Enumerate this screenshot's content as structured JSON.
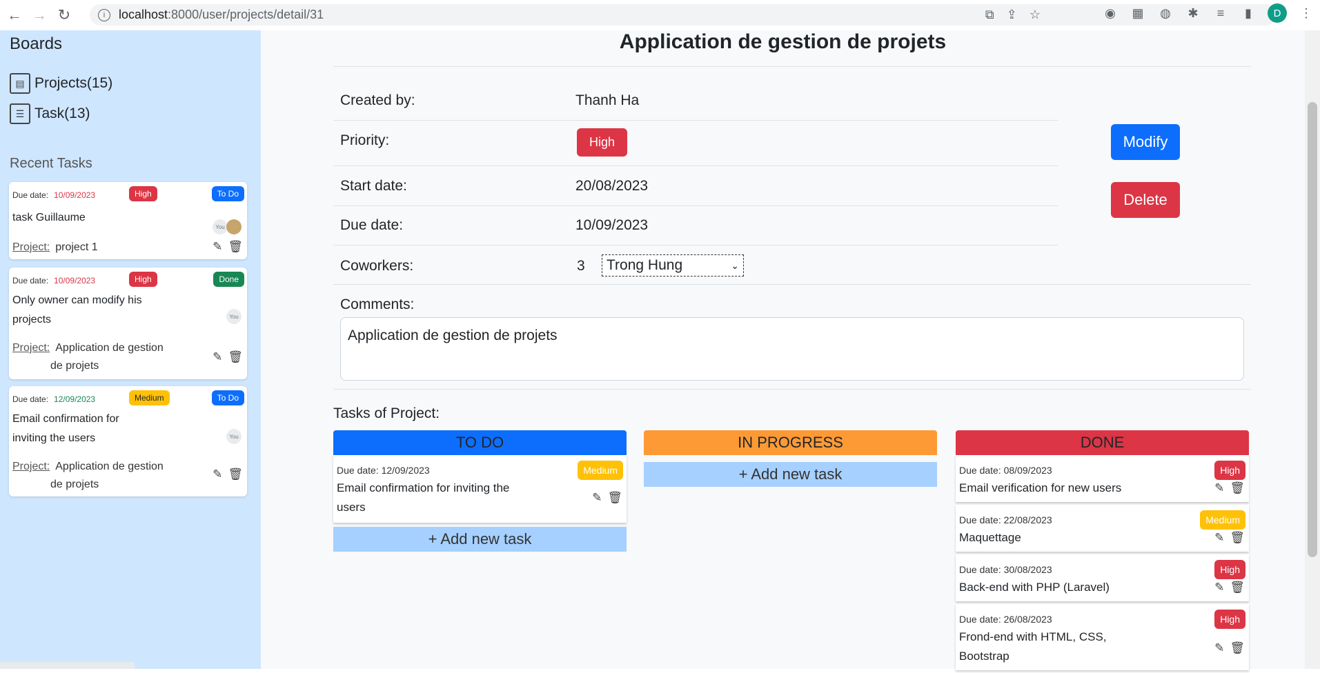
{
  "browser": {
    "url_host": "localhost",
    "url_path": ":8000/user/projects/detail/31",
    "avatar_letter": "D"
  },
  "sidebar": {
    "title": "Boards",
    "links": [
      {
        "label": "Projects(15)"
      },
      {
        "label": "Task(13)"
      }
    ],
    "recent_title": "Recent Tasks",
    "due_label": "Due date:",
    "project_label": "Project:",
    "you_label": "You",
    "tasks": [
      {
        "date": "10/09/2023",
        "priority": "High",
        "status": "To Do",
        "title": "task Guillaume",
        "project": "project 1"
      },
      {
        "date": "10/09/2023",
        "priority": "High",
        "status": "Done",
        "title_line1": "Only owner can modify his",
        "title_line2": "projects",
        "project_line1": "Application de gestion",
        "project_line2": "de projets"
      },
      {
        "date": "12/09/2023",
        "priority": "Medium",
        "status": "To Do",
        "title_line1": "Email confirmation for",
        "title_line2": "inviting the users",
        "project_line1": "Application de gestion",
        "project_line2": "de projets"
      }
    ]
  },
  "project": {
    "title": "Application de gestion de projets",
    "created_by_label": "Created by:",
    "created_by": "Thanh Ha",
    "priority_label": "Priority:",
    "priority": "High",
    "start_label": "Start date:",
    "start_date": "20/08/2023",
    "due_label": "Due date:",
    "due_date": "10/09/2023",
    "coworkers_label": "Coworkers:",
    "coworkers_count": "3",
    "coworker_selected": "Trong Hung",
    "comments_label": "Comments:",
    "comments": "Application de gestion de projets",
    "modify_label": "Modify",
    "delete_label": "Delete"
  },
  "board": {
    "title": "Tasks of Project:",
    "due_prefix": "Due date: ",
    "add_label": "+ Add new task",
    "columns": [
      {
        "name": "TO DO",
        "cards": [
          {
            "date": "12/09/2023",
            "priority": "Medium",
            "title_line1": "Email confirmation for inviting the",
            "title_line2": "users"
          }
        ]
      },
      {
        "name": "IN PROGRESS",
        "cards": []
      },
      {
        "name": "DONE",
        "cards": [
          {
            "date": "08/09/2023",
            "priority": "High",
            "title": "Email verification for new users"
          },
          {
            "date": "22/08/2023",
            "priority": "Medium",
            "title": "Maquettage"
          },
          {
            "date": "30/08/2023",
            "priority": "High",
            "title": "Back-end with PHP (Laravel)"
          },
          {
            "date": "26/08/2023",
            "priority": "High",
            "title_line1": "Frond-end with HTML, CSS,",
            "title_line2": "Bootstrap"
          }
        ]
      }
    ]
  },
  "colors": {
    "sidebar_bg": "#cfe6ff",
    "todo": "#0d6efd",
    "in_progress": "#fd9a35",
    "done": "#dc3545",
    "add_task": "#a6d0ff"
  }
}
